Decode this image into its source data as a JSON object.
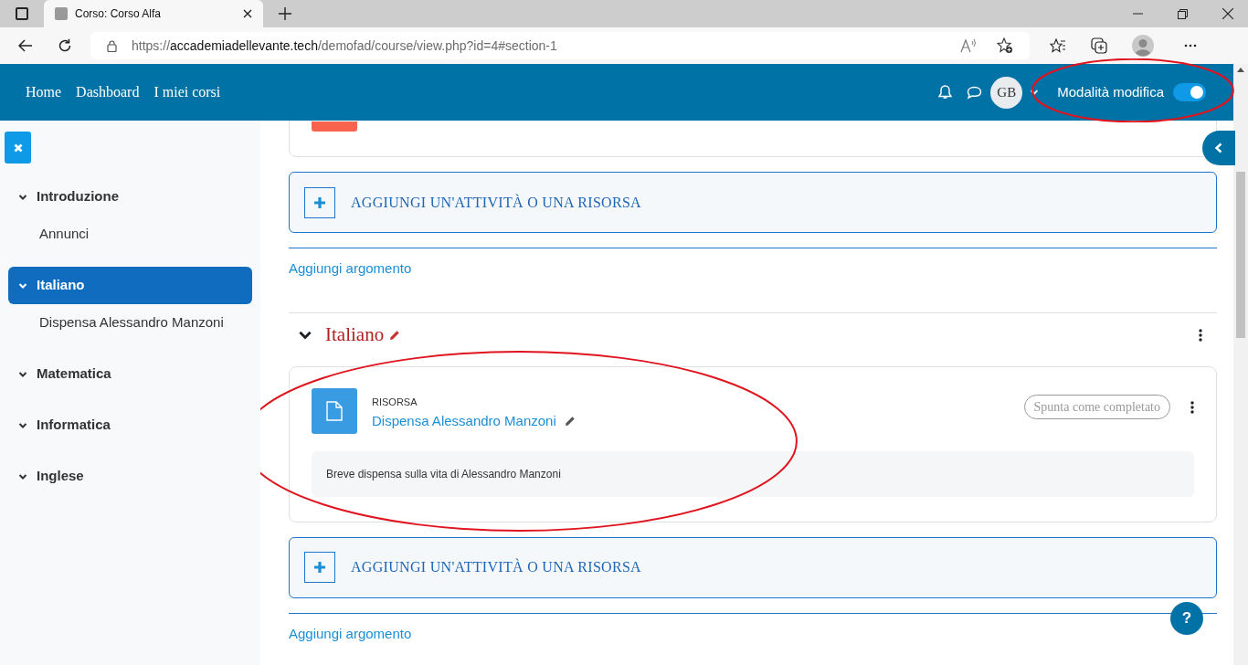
{
  "browser": {
    "tab_title": "Corso: Corso Alfa",
    "url_scheme": "https://",
    "url_host": "accademiadellevante.tech",
    "url_path": "/demofad/course/view.php?id=4#section-1"
  },
  "navbar": {
    "links": [
      {
        "label": "Home"
      },
      {
        "label": "Dashboard"
      },
      {
        "label": "I miei corsi"
      }
    ],
    "avatar": "GB",
    "edit_mode": {
      "label": "Modalità modifica",
      "on": true,
      "circled": true
    }
  },
  "sidebar": {
    "sections": [
      {
        "title": "Introduzione",
        "selected": false,
        "expanded": true,
        "children": [
          {
            "label": "Annunci"
          }
        ]
      },
      {
        "title": "Italiano",
        "selected": true,
        "expanded": true,
        "children": [
          {
            "label": "Dispensa Alessandro Manzoni"
          }
        ]
      },
      {
        "title": "Matematica",
        "selected": false,
        "expanded": true
      },
      {
        "title": "Informatica",
        "selected": false,
        "expanded": true
      },
      {
        "title": "Inglese",
        "selected": false,
        "expanded": true
      }
    ]
  },
  "content": {
    "add_activity_1": "AGGIUNGI UN'ATTIVITÀ O UNA RISORSA",
    "add_topic_1": "Aggiungi argomento",
    "section": {
      "title": "Italiano",
      "expanded": true,
      "activity": {
        "type": "RISORSA",
        "name": "Dispensa Alessandro Manzoni",
        "completion": "Spunta come completato",
        "description": "Breve dispensa sulla vita di Alessandro Manzoni",
        "circled": true
      }
    },
    "add_activity_2": "AGGIUNGI UN'ATTIVITÀ O UNA RISORSA",
    "add_topic_2": "Aggiungi argomento"
  },
  "help_button": "?"
}
